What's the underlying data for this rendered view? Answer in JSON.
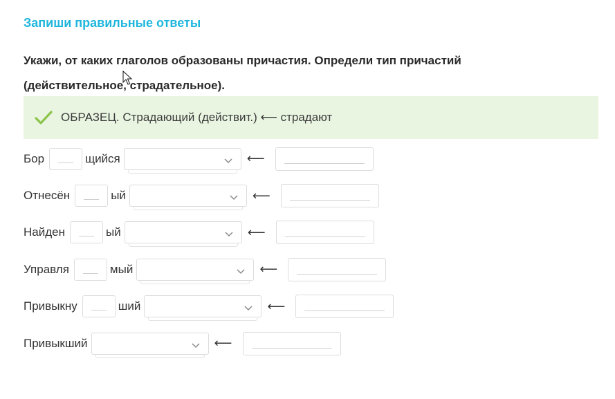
{
  "header": {
    "title": "Запиши правильные ответы",
    "instruction": "Укажи, от каких глаголов образованы причастия. Определи тип причастий (действительное, страдательное)."
  },
  "sample": {
    "icon": "check-icon",
    "text": "ОБРАЗЕЦ. Страдающий (действит.) ⟵ страдают",
    "accent_color": "#8bc34a",
    "background": "#e9f5e1"
  },
  "arrow_glyph": "⟵",
  "rows": [
    {
      "prefix": "Бор",
      "suffix": "щийся",
      "letter_value": "",
      "type_value": "",
      "verb_value": ""
    },
    {
      "prefix": "Отнесён",
      "suffix": "ый",
      "letter_value": "",
      "type_value": "",
      "verb_value": ""
    },
    {
      "prefix": "Найден",
      "suffix": "ый",
      "letter_value": "",
      "type_value": "",
      "verb_value": ""
    },
    {
      "prefix": "Управля",
      "suffix": "мый",
      "letter_value": "",
      "type_value": "",
      "verb_value": ""
    },
    {
      "prefix": "Привыкну",
      "suffix": "ший",
      "letter_value": "",
      "type_value": "",
      "verb_value": ""
    },
    {
      "prefix": "Привыкший",
      "suffix": "",
      "type_value": "",
      "verb_value": ""
    }
  ],
  "colors": {
    "title": "#1fb6dd",
    "border": "#dcdcdc"
  }
}
